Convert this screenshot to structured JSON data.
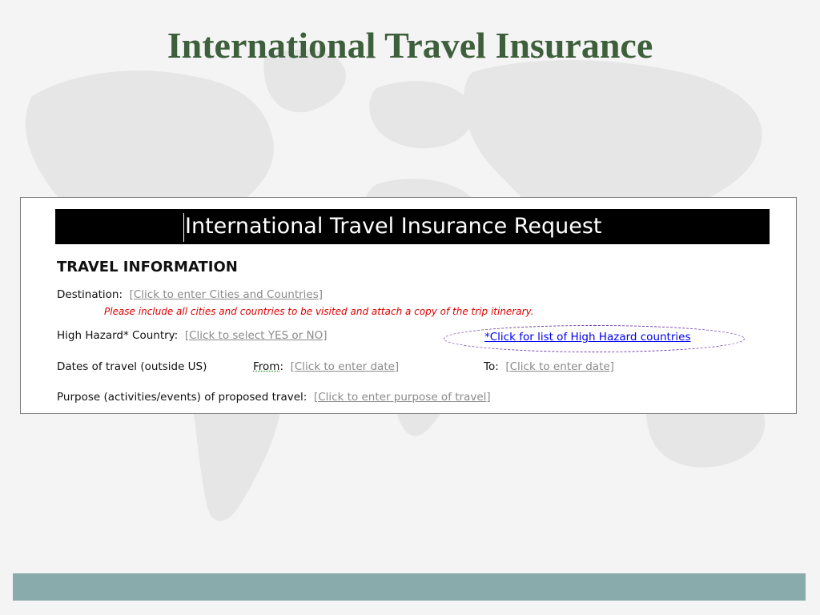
{
  "slide": {
    "title": "International Travel Insurance"
  },
  "form": {
    "header": "International Travel Insurance Request",
    "section_heading": "TRAVEL INFORMATION",
    "destination": {
      "label": "Destination:",
      "placeholder": "[Click to enter Cities and Countries]",
      "note": "Please include all cities and countries to be visited and attach a copy of the trip itinerary."
    },
    "hazard": {
      "label": "High Hazard* Country:",
      "placeholder": "[Click to select YES or NO]",
      "link": "*Click for list of High Hazard countries"
    },
    "dates": {
      "label": "Dates of travel (outside US)",
      "from_label": "From",
      "from_colon": ":",
      "from_placeholder": "[Click to enter date]",
      "to_label": "To:",
      "to_placeholder": "[Click to enter date]"
    },
    "purpose": {
      "label": "Purpose (activities/events) of proposed travel:",
      "placeholder": "[Click to enter purpose of travel]"
    }
  },
  "colors": {
    "title": "#3e5f3b",
    "header_bg": "#000000",
    "note": "#e00000",
    "link": "#0000ee",
    "footer": "#8aabab"
  }
}
